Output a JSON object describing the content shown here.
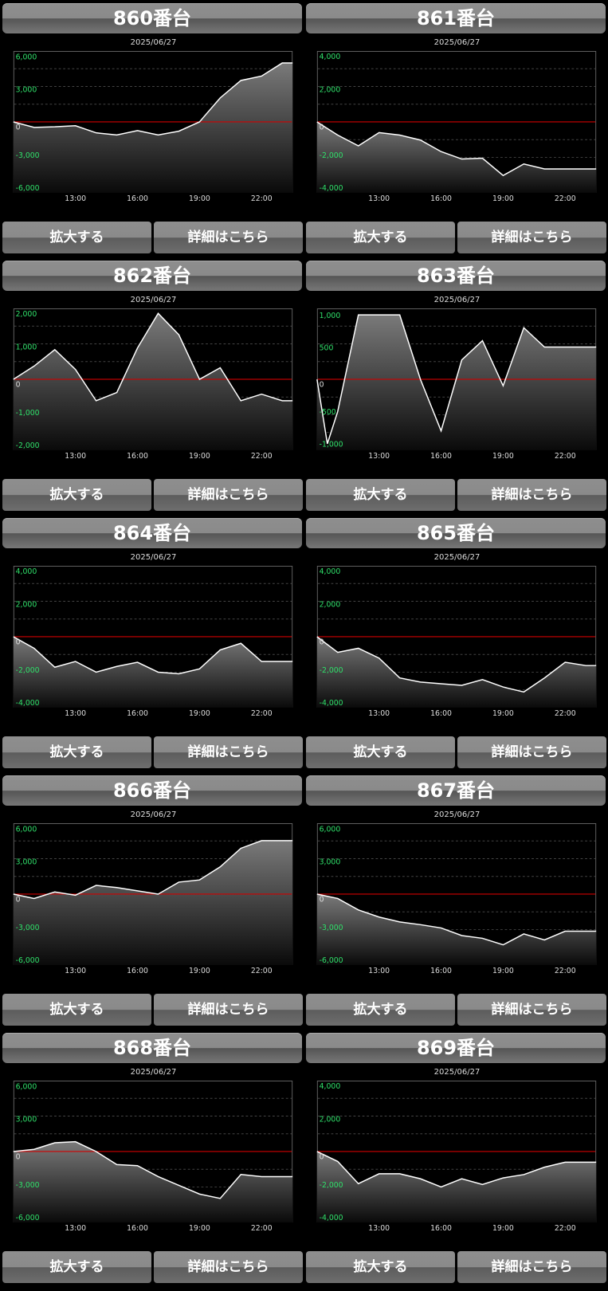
{
  "labels": {
    "zoom_button": "拡大する",
    "detail_button": "詳細はこちら"
  },
  "colors": {
    "ytick": "#2fe06a",
    "zero_line": "#d00000",
    "line": "#ffffff",
    "background": "#000000"
  },
  "charts": [
    {
      "title": "860番台",
      "date": "2025/06/27",
      "chart_data": {
        "type": "area",
        "ylim": [
          -6500,
          6500
        ],
        "yticks": [
          6000,
          3000,
          -3000,
          -6000
        ],
        "xticks": [
          "13:00",
          "16:00",
          "19:00",
          "22:00"
        ],
        "x": [
          10.0,
          11,
          12,
          13,
          14,
          15,
          16,
          17,
          18,
          19,
          20,
          21,
          22,
          23
        ],
        "values": [
          0,
          -500,
          -450,
          -350,
          -1000,
          -1200,
          -800,
          -1200,
          -850,
          0,
          2200,
          3800,
          4200,
          5400
        ]
      }
    },
    {
      "title": "861番台",
      "date": "2025/06/27",
      "chart_data": {
        "type": "area",
        "ylim": [
          -4300,
          4300
        ],
        "yticks": [
          4000,
          2000,
          -2000,
          -4000
        ],
        "xticks": [
          "13:00",
          "16:00",
          "19:00",
          "22:00"
        ],
        "x": [
          10.0,
          11,
          12,
          13,
          14,
          15,
          16,
          17,
          18,
          19,
          20,
          21,
          22,
          23
        ],
        "values": [
          0,
          -800,
          -1450,
          -650,
          -800,
          -1100,
          -1800,
          -2250,
          -2200,
          -3250,
          -2550,
          -2850,
          -2850,
          -2850
        ]
      }
    },
    {
      "title": "862番台",
      "date": "2025/06/27",
      "chart_data": {
        "type": "area",
        "ylim": [
          -2150,
          2150
        ],
        "yticks": [
          2000,
          1000,
          -1000,
          -2000
        ],
        "xticks": [
          "13:00",
          "16:00",
          "19:00",
          "22:00"
        ],
        "x": [
          10.0,
          11,
          12,
          13,
          14,
          15,
          16,
          17,
          18,
          19,
          20,
          21,
          22,
          23
        ],
        "values": [
          0,
          400,
          900,
          300,
          -650,
          -400,
          950,
          2000,
          1350,
          0,
          350,
          -650,
          -450,
          -650
        ]
      }
    },
    {
      "title": "863番台",
      "date": "2025/06/27",
      "chart_data": {
        "type": "area",
        "ylim": [
          -1100,
          1100
        ],
        "yticks": [
          1000,
          500,
          -500,
          -1000
        ],
        "xticks": [
          "13:00",
          "16:00",
          "19:00",
          "22:00"
        ],
        "x": [
          10.0,
          10.5,
          11,
          12,
          13,
          14,
          15,
          16,
          17,
          18,
          19,
          20,
          21,
          22,
          23
        ],
        "values": [
          0,
          -1000,
          -500,
          1000,
          1000,
          1000,
          0,
          -800,
          300,
          600,
          -100,
          800,
          500,
          500,
          500
        ]
      }
    },
    {
      "title": "864番台",
      "date": "2025/06/27",
      "chart_data": {
        "type": "area",
        "ylim": [
          -4300,
          4300
        ],
        "yticks": [
          4000,
          2000,
          -2000,
          -4000
        ],
        "xticks": [
          "13:00",
          "16:00",
          "19:00",
          "22:00"
        ],
        "x": [
          10.0,
          11,
          12,
          13,
          14,
          15,
          16,
          17,
          18,
          19,
          20,
          21,
          22,
          23
        ],
        "values": [
          0,
          -700,
          -1850,
          -1500,
          -2150,
          -1800,
          -1550,
          -2150,
          -2250,
          -1950,
          -800,
          -400,
          -1500,
          -1500
        ]
      }
    },
    {
      "title": "865番台",
      "date": "2025/06/27",
      "chart_data": {
        "type": "area",
        "ylim": [
          -4300,
          4300
        ],
        "yticks": [
          4000,
          2000,
          -2000,
          -4000
        ],
        "xticks": [
          "13:00",
          "16:00",
          "19:00",
          "22:00"
        ],
        "x": [
          10.0,
          11,
          12,
          13,
          14,
          15,
          16,
          17,
          18,
          19,
          20,
          21,
          22,
          23
        ],
        "values": [
          0,
          -950,
          -700,
          -1300,
          -2500,
          -2750,
          -2850,
          -2950,
          -2600,
          -3050,
          -3350,
          -2500,
          -1550,
          -1750
        ]
      }
    },
    {
      "title": "866番台",
      "date": "2025/06/27",
      "chart_data": {
        "type": "area",
        "ylim": [
          -6500,
          6500
        ],
        "yticks": [
          6000,
          3000,
          -3000,
          -6000
        ],
        "xticks": [
          "13:00",
          "16:00",
          "19:00",
          "22:00"
        ],
        "x": [
          10.0,
          11,
          12,
          13,
          14,
          15,
          16,
          17,
          18,
          19,
          20,
          21,
          22,
          23
        ],
        "values": [
          0,
          -400,
          200,
          -100,
          800,
          600,
          300,
          0,
          1100,
          1300,
          2500,
          4200,
          4900,
          4900
        ]
      }
    },
    {
      "title": "867番台",
      "date": "2025/06/27",
      "chart_data": {
        "type": "area",
        "ylim": [
          -6500,
          6500
        ],
        "yticks": [
          6000,
          3000,
          -3000,
          -6000
        ],
        "xticks": [
          "13:00",
          "16:00",
          "19:00",
          "22:00"
        ],
        "x": [
          10.0,
          11,
          12,
          13,
          14,
          15,
          16,
          17,
          18,
          19,
          20,
          21,
          22,
          23
        ],
        "values": [
          0,
          -400,
          -1450,
          -2100,
          -2550,
          -2800,
          -3100,
          -3800,
          -4050,
          -4650,
          -3650,
          -4200,
          -3400,
          -3400
        ]
      }
    },
    {
      "title": "868番台",
      "date": "2025/06/27",
      "chart_data": {
        "type": "area",
        "ylim": [
          -6500,
          6500
        ],
        "yticks": [
          6000,
          3000,
          -3000,
          -6000
        ],
        "xticks": [
          "13:00",
          "16:00",
          "19:00",
          "22:00"
        ],
        "x": [
          10.0,
          11,
          12,
          13,
          14,
          15,
          16,
          17,
          18,
          19,
          20,
          21,
          22,
          23
        ],
        "values": [
          0,
          200,
          800,
          900,
          0,
          -1200,
          -1300,
          -2300,
          -3100,
          -3900,
          -4300,
          -2100,
          -2300,
          -2300
        ]
      }
    },
    {
      "title": "869番台",
      "date": "2025/06/27",
      "chart_data": {
        "type": "area",
        "ylim": [
          -4300,
          4300
        ],
        "yticks": [
          4000,
          2000,
          -2000,
          -4000
        ],
        "xticks": [
          "13:00",
          "16:00",
          "19:00",
          "22:00"
        ],
        "x": [
          10.0,
          11,
          12,
          13,
          14,
          15,
          16,
          17,
          18,
          19,
          20,
          21,
          22,
          23
        ],
        "values": [
          0,
          -600,
          -1950,
          -1350,
          -1350,
          -1650,
          -2150,
          -1650,
          -2000,
          -1600,
          -1400,
          -950,
          -650,
          -650
        ]
      }
    }
  ]
}
